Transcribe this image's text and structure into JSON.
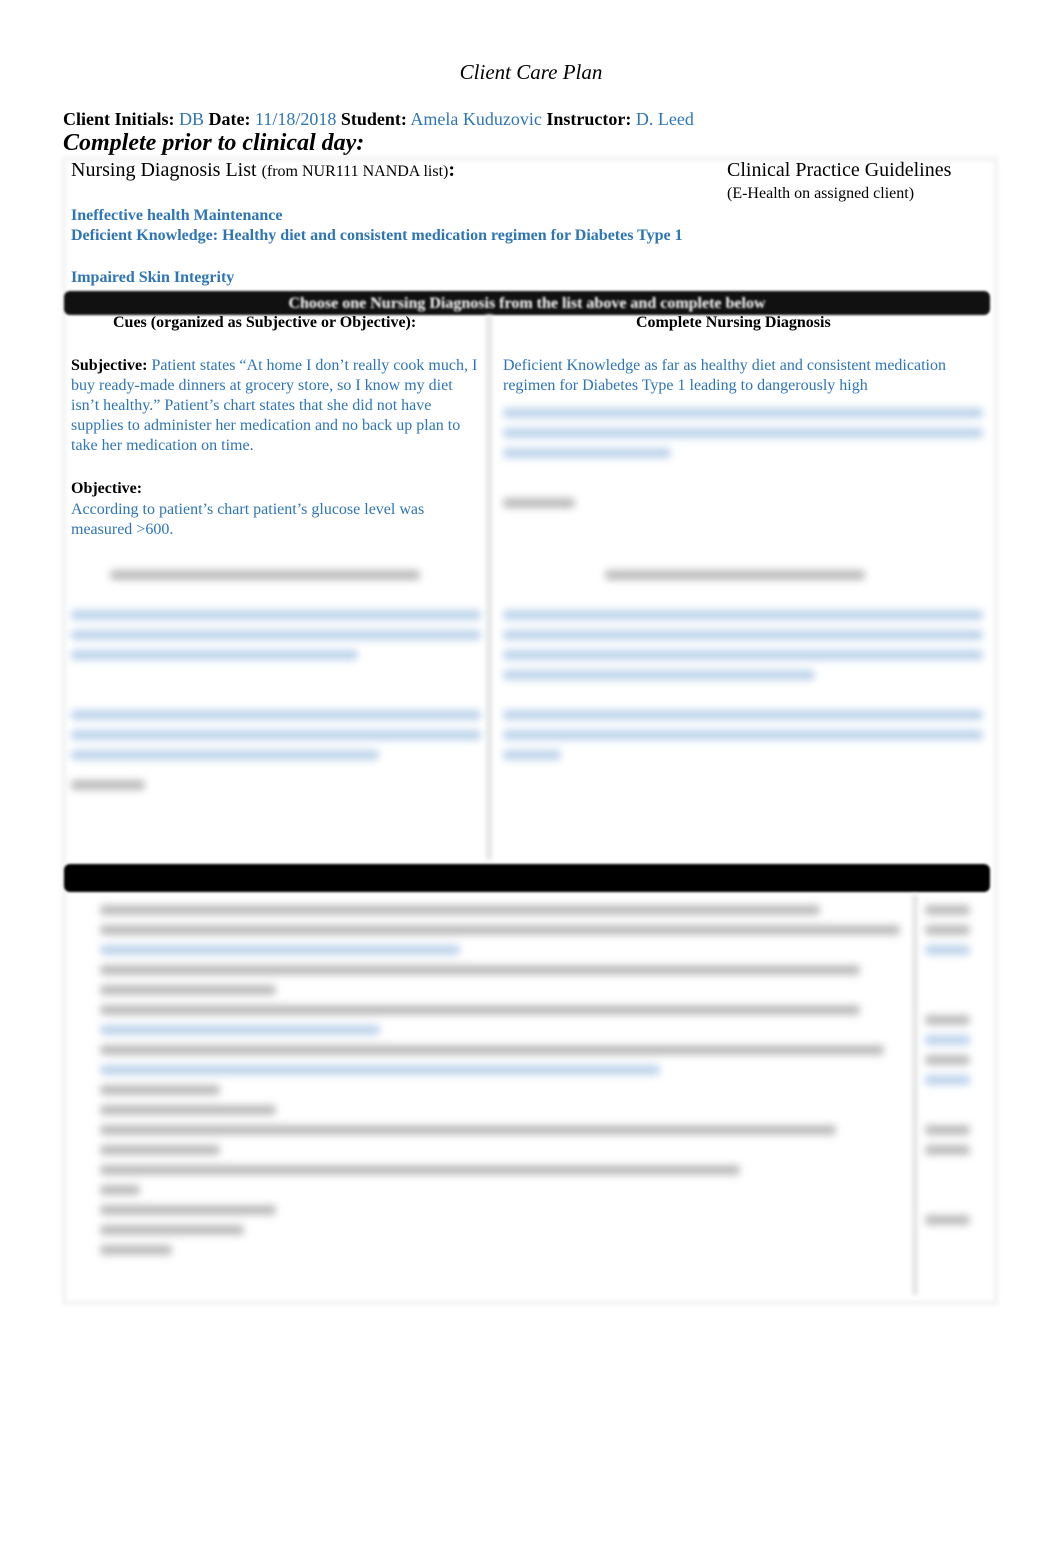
{
  "title": "Client Care Plan",
  "header": {
    "initials_label": "Client Initials:",
    "initials": "DB",
    "date_label": "Date:",
    "date": "11/18/2018",
    "student_label": "Student:",
    "student": "Amela Kuduzovic",
    "instructor_label": "Instructor:",
    "instructor": "D. Leed"
  },
  "prior": "Complete prior to clinical day:",
  "diagnosis_list": {
    "label": "Nursing Diagnosis List",
    "sub": "(from NUR111 NANDA list)",
    "colon": ":",
    "items": [
      "Ineffective health Maintenance",
      "Deficient Knowledge: Healthy diet and consistent medication regimen for Diabetes Type 1",
      "Impaired Skin Integrity"
    ]
  },
  "guidelines": {
    "label": "Clinical Practice Guidelines",
    "sub": "(E-Health on assigned client)"
  },
  "choose_bar": "Choose one Nursing Diagnosis from the list above and complete below",
  "cues": {
    "header": "Cues (organized as Subjective or Objective):",
    "subjective_label": "Subjective:",
    "subjective": "Patient states “At home I don’t really cook much, I buy ready-made dinners at grocery store, so I know my diet isn’t healthy.” Patient’s chart states that she did not have supplies to administer her medication and no back up plan to take her medication on time.",
    "objective_label": "Objective:",
    "objective": "According to patient’s chart patient’s glucose level was measured >600."
  },
  "complete_dx": {
    "header": "Complete Nursing Diagnosis",
    "text": "Deficient Knowledge as far as healthy diet and consistent medication regimen for Diabetes Type 1 leading to dangerously high"
  }
}
